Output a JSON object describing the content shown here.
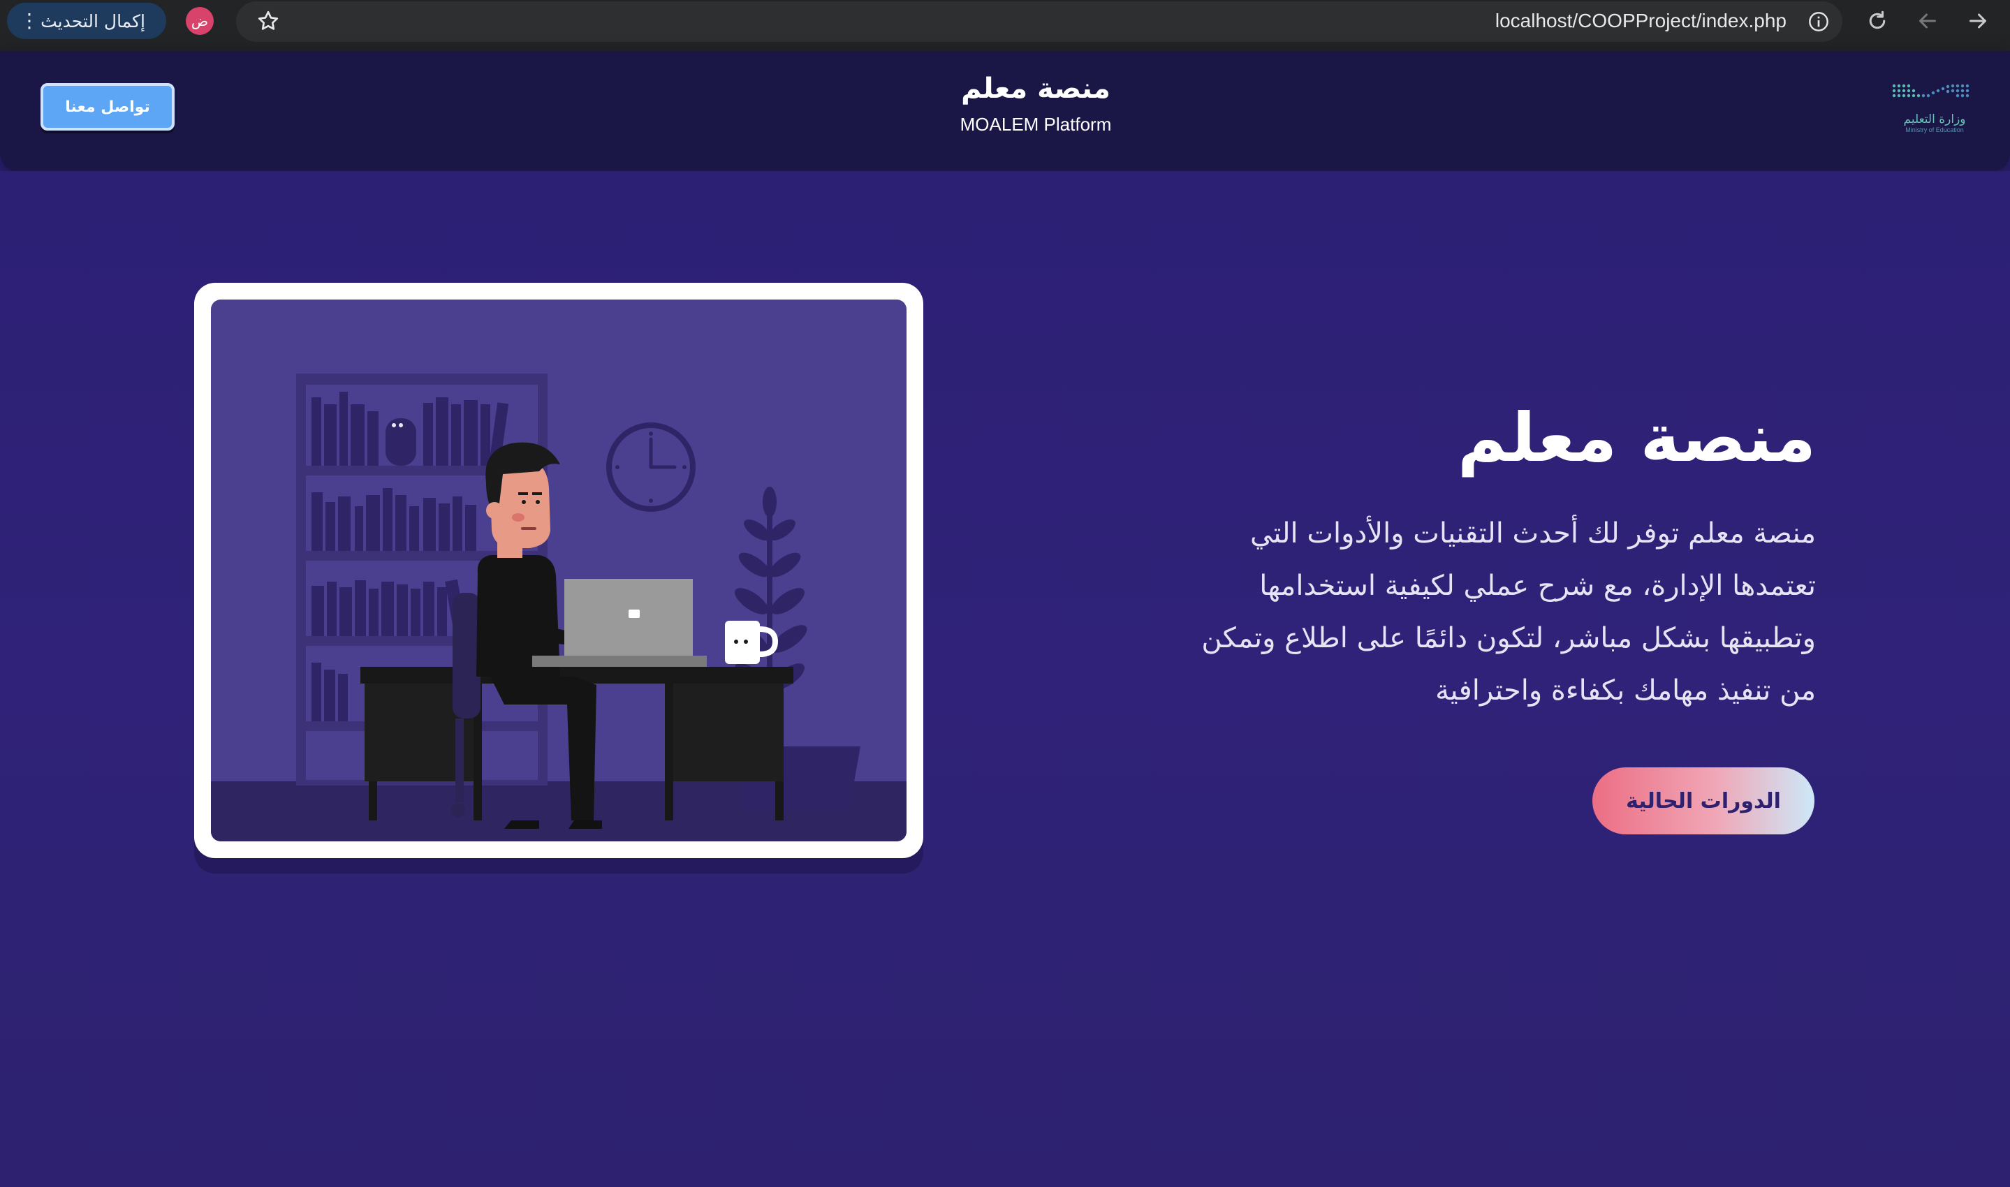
{
  "browser": {
    "update_button_label": "إكمال التحديث",
    "profile_initial": "ض",
    "url": "localhost/COOPProject/index.php"
  },
  "header": {
    "contact_button_label": "تواصل معنا",
    "brand_title": "منصة معلم",
    "brand_subtitle": "MOALEM Platform",
    "logo_text_ar": "وزارة التعليم",
    "logo_text_en": "Ministry of Education"
  },
  "hero": {
    "title": "منصة معلم",
    "description": "منصة معلم توفر لك أحدث التقنيات والأدوات التي تعتمدها الإدارة، مع شرح عملي لكيفية استخدامها وتطبيقها بشكل مباشر، لتكون دائمًا على اطلاع وتمكن من تنفيذ مهامك بكفاءة واحترافية",
    "courses_button_label": "الدورات الحالية"
  },
  "colors": {
    "page_background": "#2d2170",
    "header_background": "#1a1645",
    "contact_button": "#5da6f5",
    "illustration_background": "#4b3f8f"
  }
}
